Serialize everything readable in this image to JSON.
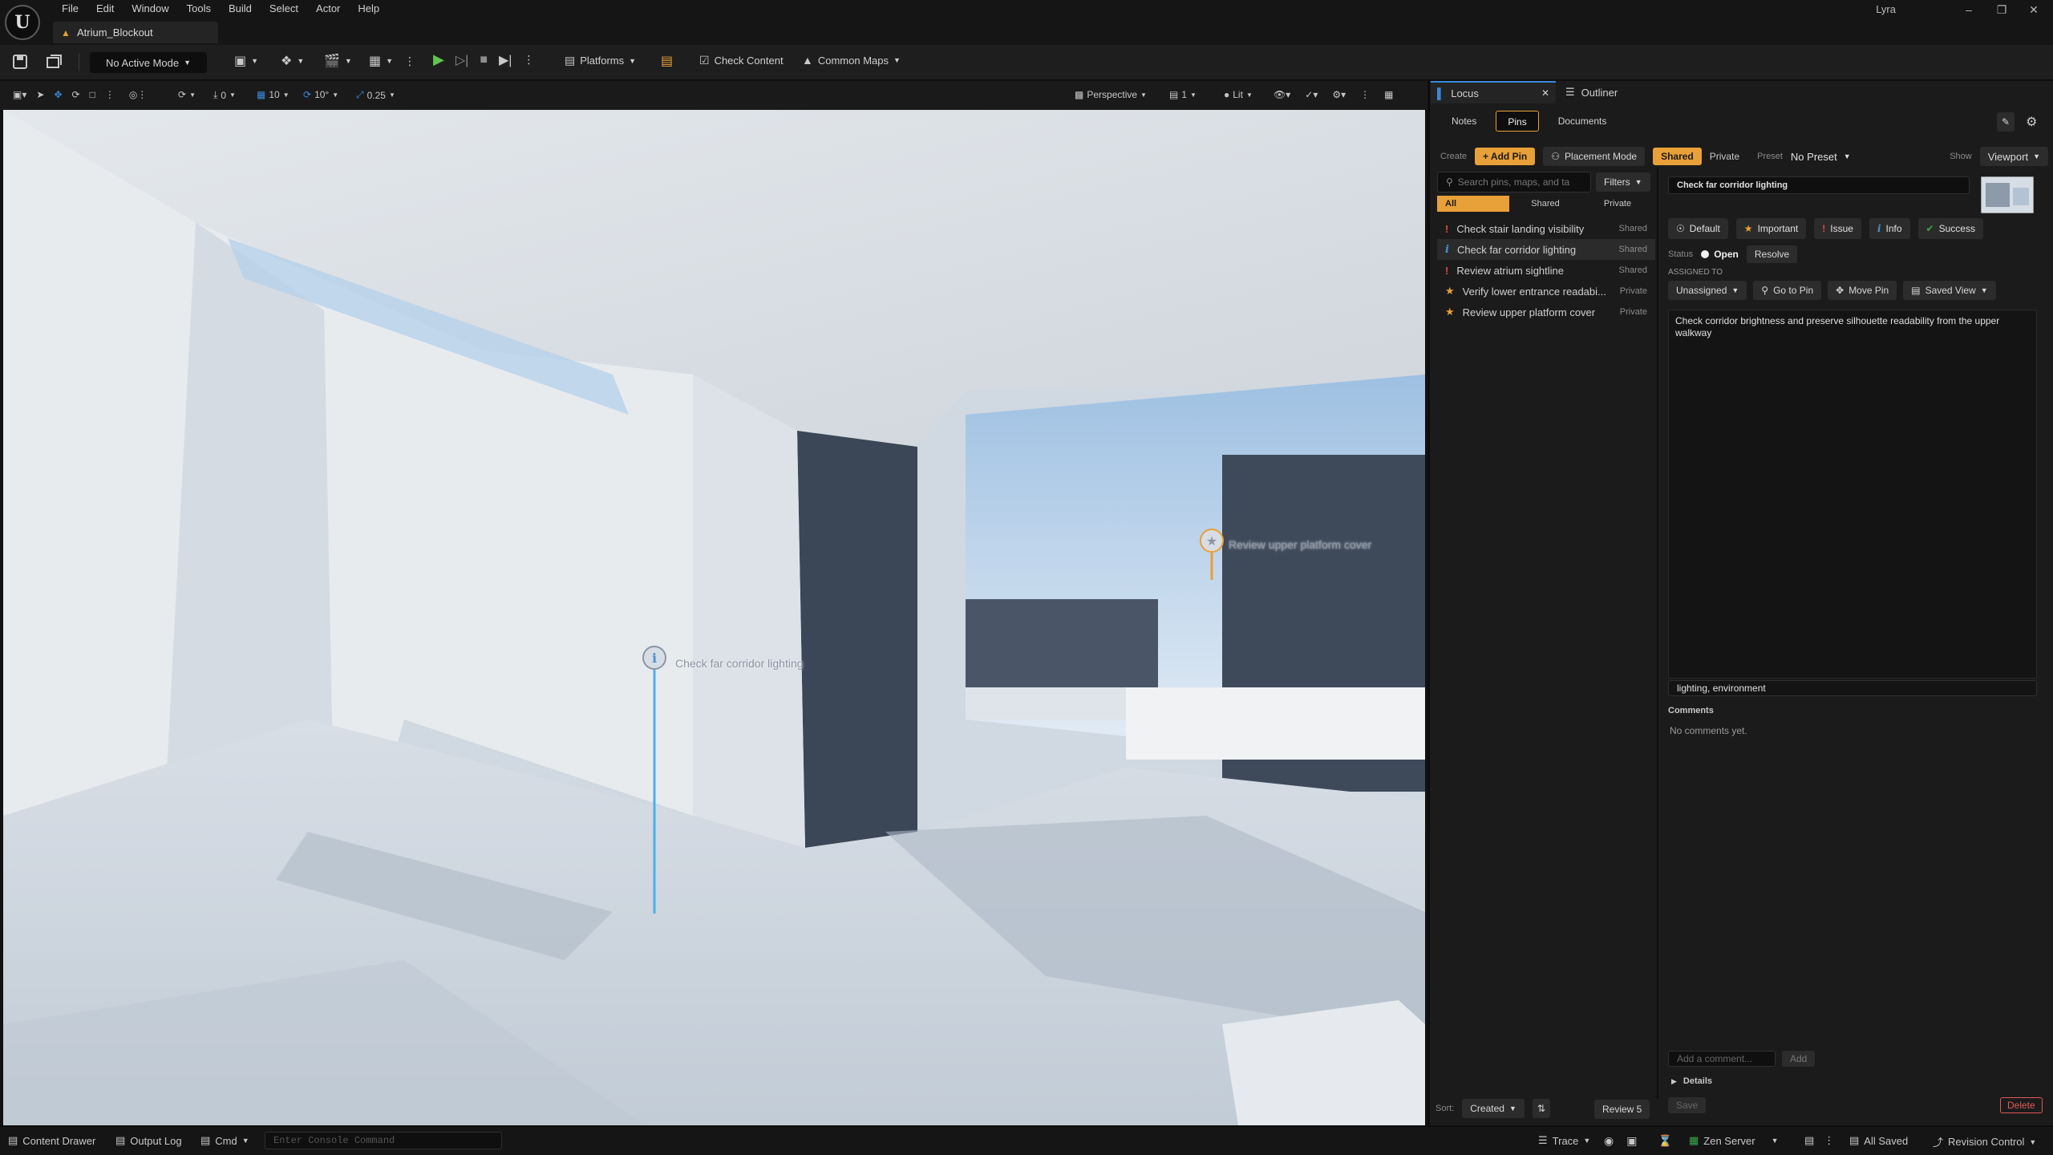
{
  "app": {
    "logo_letter": "U",
    "menu": [
      "File",
      "Edit",
      "Window",
      "Tools",
      "Build",
      "Select",
      "Actor",
      "Help"
    ],
    "document_tab": "Atrium_Blockout",
    "project_name": "Lyra"
  },
  "toolbar": {
    "mode_label": "No Active Mode",
    "platforms_label": "Platforms",
    "check_content_label": "Check Content",
    "common_maps_label": "Common Maps"
  },
  "viewport_toolbar": {
    "translate_snap": "10",
    "rotate_snap": "10°",
    "scale_snap": "0.25",
    "angle_value": "0",
    "view_mode": "Perspective",
    "camera_speed": "1",
    "lighting_mode": "Lit"
  },
  "viewport": {
    "pins": [
      {
        "label": "Check far corridor lighting",
        "type": "info"
      },
      {
        "label": "Review upper platform cover",
        "type": "important"
      }
    ]
  },
  "panel": {
    "tabs": [
      {
        "label": "Locus",
        "active": true
      },
      {
        "label": "Outliner",
        "active": false
      }
    ],
    "subtabs": [
      "Notes",
      "Pins",
      "Documents"
    ],
    "active_subtab": "Pins",
    "create_label": "Create",
    "add_pin_label": "+ Add Pin",
    "placement_mode_label": "Placement Mode",
    "visibility_options": [
      "Shared",
      "Private"
    ],
    "active_visibility": "Shared",
    "preset_label": "Preset",
    "preset_value": "No Preset",
    "show_label": "Show",
    "show_value": "Viewport",
    "search_placeholder": "Search pins, maps, and ta",
    "filters_label": "Filters",
    "filter_tabs": [
      "All",
      "Shared",
      "Private"
    ],
    "active_filter": "All",
    "pins": [
      {
        "title": "Check stair landing visibility",
        "visibility": "Shared",
        "type": "issue",
        "selected": false
      },
      {
        "title": "Check far corridor lighting",
        "visibility": "Shared",
        "type": "info",
        "selected": true
      },
      {
        "title": "Review atrium sightline",
        "visibility": "Shared",
        "type": "issue",
        "selected": false
      },
      {
        "title": "Verify lower entrance readabi...",
        "visibility": "Private",
        "type": "important",
        "selected": false
      },
      {
        "title": "Review upper platform cover",
        "visibility": "Private",
        "type": "important",
        "selected": false
      }
    ],
    "sort_label": "Sort:",
    "sort_value": "Created",
    "review_label": "Review 5",
    "detail": {
      "title": "Check far corridor lighting",
      "types": [
        "Default",
        "Important",
        "Issue",
        "Info",
        "Success"
      ],
      "status_label": "Status",
      "status_value": "Open",
      "resolve_label": "Resolve",
      "assigned_label": "ASSIGNED TO",
      "assignee": "Unassigned",
      "go_to_pin_label": "Go to Pin",
      "move_pin_label": "Move Pin",
      "saved_view_label": "Saved View",
      "description": "Check corridor brightness and preserve silhouette readability from the upper walkway",
      "tags": "lighting, environment",
      "comments_label": "Comments",
      "comments_empty": "No comments yet.",
      "comment_placeholder": "Add a comment...",
      "add_label": "Add",
      "details_label": "Details",
      "save_label": "Save",
      "delete_label": "Delete"
    },
    "colors": {
      "accent": "#e8a038",
      "issue": "#e04848",
      "info": "#4a90d9",
      "success": "#3ca84c",
      "tab_underline": "#3a88d8"
    }
  },
  "statusbar": {
    "content_drawer": "Content Drawer",
    "output_log": "Output Log",
    "cmd": "Cmd",
    "console_placeholder": "Enter Console Command",
    "trace": "Trace",
    "zen_server": "Zen Server",
    "all_saved": "All Saved",
    "revision_control": "Revision Control"
  }
}
